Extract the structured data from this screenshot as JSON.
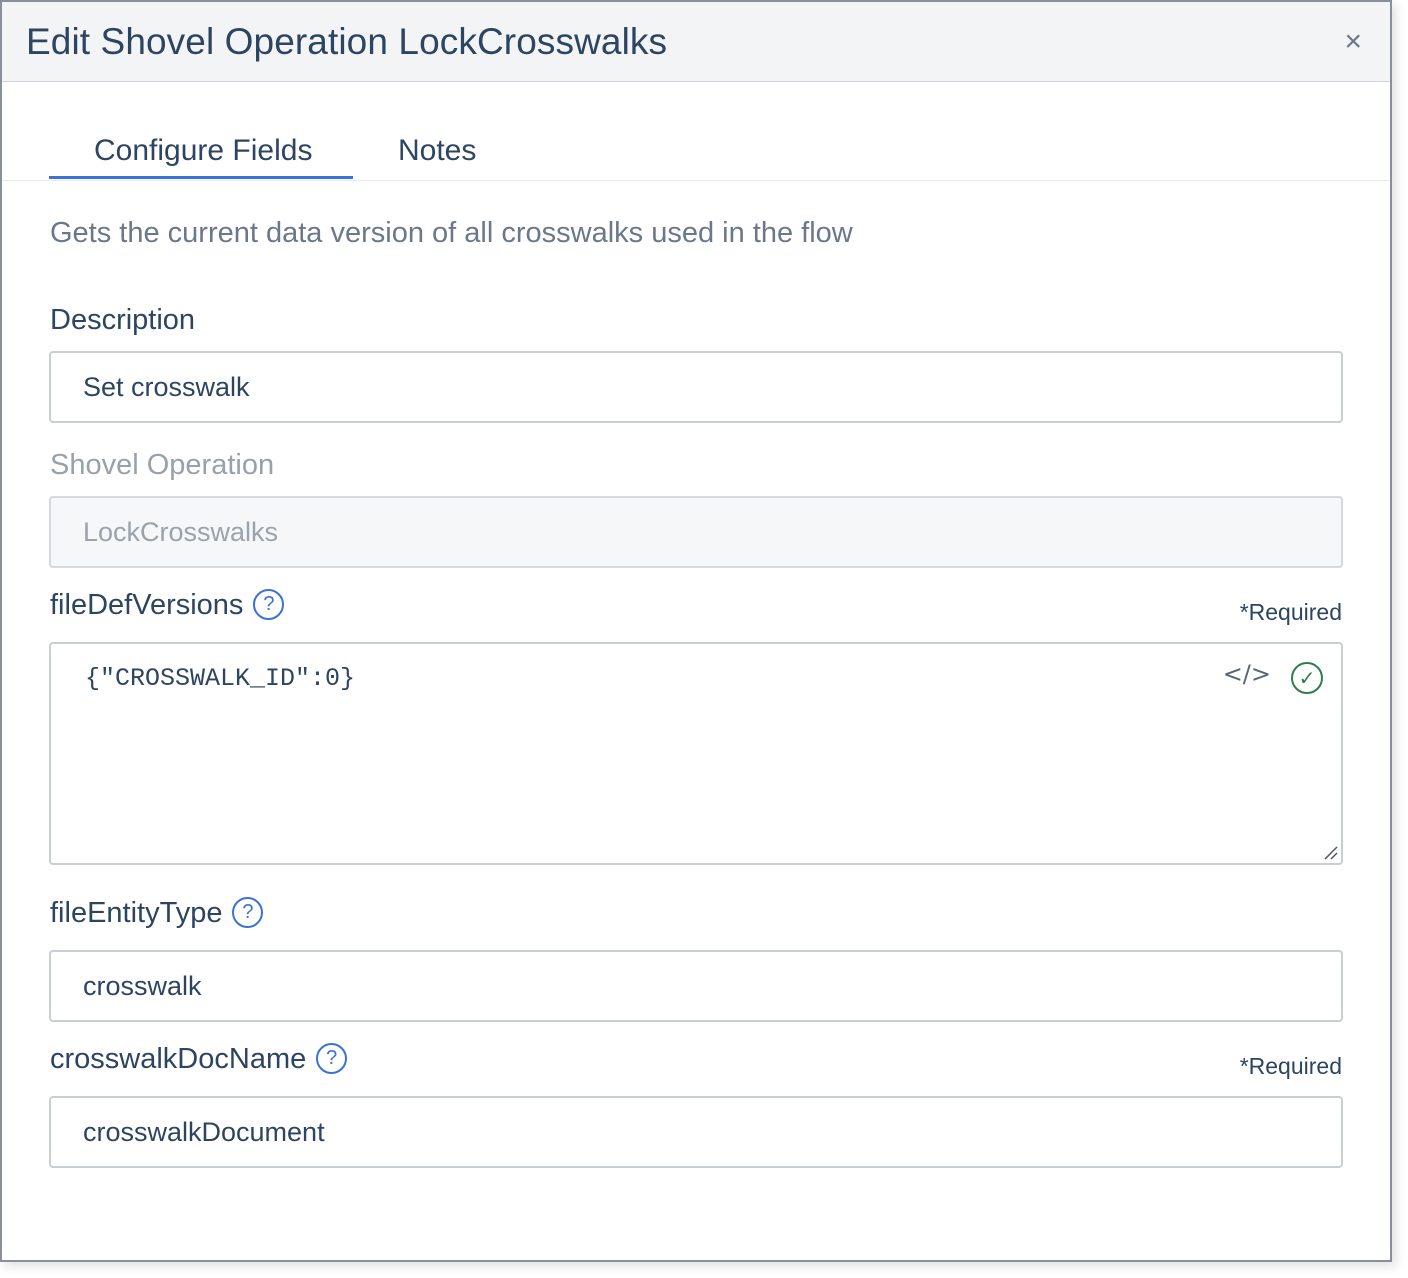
{
  "dialog": {
    "title": "Edit Shovel Operation LockCrosswalks",
    "close_glyph": "×"
  },
  "tabs": [
    {
      "label": "Configure Fields",
      "active": true
    },
    {
      "label": "Notes",
      "active": false
    }
  ],
  "subtitle": "Gets the current data version of all crosswalks used in the flow",
  "fields": {
    "description": {
      "label": "Description",
      "value": "Set crosswalk"
    },
    "shovel_operation": {
      "label": "Shovel Operation",
      "value": "LockCrosswalks",
      "disabled": true
    },
    "file_def_versions": {
      "label": "fileDefVersions",
      "required": "*Required",
      "value": "{\"CROSSWALK_ID\":0}",
      "help": "?",
      "source_icon": "</>",
      "valid_icon": "✓"
    },
    "file_entity_type": {
      "label": "fileEntityType",
      "value": "crosswalk",
      "help": "?"
    },
    "crosswalk_doc_name": {
      "label": "crosswalkDocName",
      "required": "*Required",
      "value": "crosswalkDocument",
      "help": "?"
    }
  },
  "colors": {
    "accent": "#3c72d6",
    "valid": "#2e7d4f"
  }
}
